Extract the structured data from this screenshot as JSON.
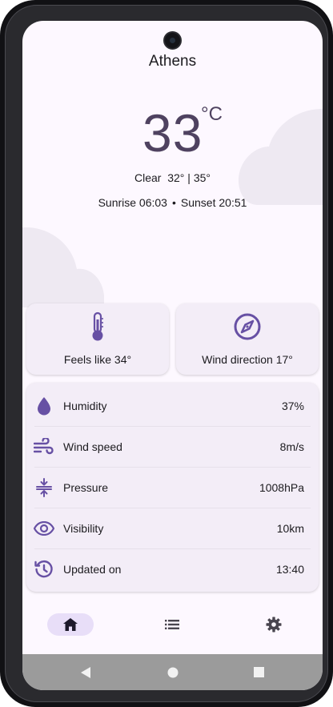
{
  "location": {
    "city": "Athens"
  },
  "current": {
    "temperature": "33",
    "unit": "°C",
    "condition_line": "Clear  32° | 35°",
    "sunrise": "Sunrise 06:03",
    "separator": "•",
    "sunset": "Sunset 20:51"
  },
  "cards": {
    "feels_like": "Feels like 34°",
    "wind_direction": "Wind direction 17°"
  },
  "details": [
    {
      "label": "Humidity",
      "value": "37%",
      "icon": "water-drop-icon"
    },
    {
      "label": "Wind speed",
      "value": "8m/s",
      "icon": "wind-icon"
    },
    {
      "label": "Pressure",
      "value": "1008hPa",
      "icon": "compress-icon"
    },
    {
      "label": "Visibility",
      "value": "10km",
      "icon": "eye-icon"
    },
    {
      "label": "Updated on",
      "value": "13:40",
      "icon": "clock-history-icon"
    }
  ],
  "bottom_nav": [
    {
      "name": "home",
      "icon": "home-icon",
      "active": true
    },
    {
      "name": "list",
      "icon": "list-icon",
      "active": false
    },
    {
      "name": "settings",
      "icon": "gear-icon",
      "active": false
    }
  ],
  "system_nav": [
    "back-icon",
    "home-circle-icon",
    "recents-icon"
  ],
  "colors": {
    "accent": "#6750a4",
    "accent_dark": "#4f4260",
    "surface": "#fdf8ff",
    "card": "#f3edf7",
    "nav_active": "#e8def8",
    "cloud": "#eee9f2"
  }
}
